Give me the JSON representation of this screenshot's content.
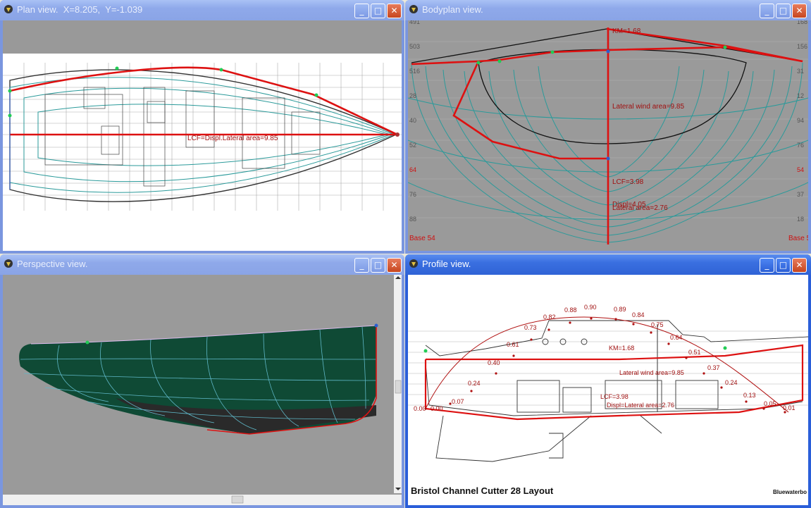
{
  "windows": {
    "plan": {
      "title": "Plan view.  X=8.205,  Y=-1.039",
      "lcf_label": "LCF=Displ.Lateral area=9.85"
    },
    "bodyplan": {
      "title": "Bodyplan view.",
      "km_label": "KM=1.68",
      "wind_label": "Lateral wind area=9.85",
      "lcf_label": "LCF=3.98",
      "displ_label": "Displ=4.05",
      "lat_label": "Lateral area=2.76",
      "base_left": "Base 54",
      "base_right": "Base 5",
      "left_ticks": [
        "491",
        "503",
        "516",
        "28",
        "40",
        "52",
        "64",
        "76",
        "88"
      ],
      "right_ticks": [
        "168",
        "156",
        "31",
        "12",
        "94",
        "76",
        "54",
        "37",
        "18"
      ]
    },
    "perspective": {
      "title": "Perspective view."
    },
    "profile": {
      "title": "Profile view.",
      "caption": "Bristol Channel Cutter 28 Layout",
      "watermark": "Bluewaterbo",
      "km_label": "KM=1.68",
      "wind_label": "Lateral wind area=9.85",
      "lcf_label": "LCF=3.98",
      "displ_label": "Displ=Lateral area=2.76",
      "curve_labels": [
        "0.00",
        "0.00",
        "0.07",
        "0.24",
        "0.40",
        "0.61",
        "0.73",
        "0.82",
        "0.88",
        "0.90",
        "0.89",
        "0.84",
        "0.75",
        "0.64",
        "0.51",
        "0.37",
        "0.24",
        "0.13",
        "0.05",
        "0.01"
      ]
    }
  },
  "buttons": {
    "minimize": "_",
    "maximize": "□",
    "close": "✕"
  },
  "colors": {
    "red": "#dd1111",
    "teal": "#2a9a9a",
    "hull": "#0f4a35",
    "active_title": "#2f63d6",
    "inactive_title": "#8aa4e6"
  }
}
